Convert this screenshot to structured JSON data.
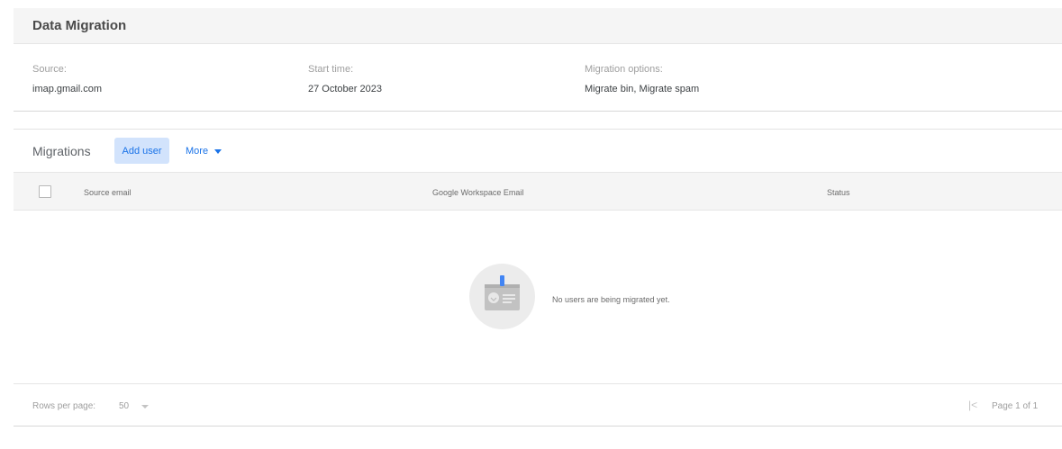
{
  "overview": {
    "title": "Data Migration",
    "source_label": "Source:",
    "source_value": "imap.gmail.com",
    "start_label": "Start time:",
    "start_value": "27 October 2023",
    "options_label": "Migration options:",
    "options_value": "Migrate bin, Migrate spam"
  },
  "migrations": {
    "title": "Migrations",
    "add_user_label": "Add user",
    "more_label": "More",
    "columns": [
      "Source email",
      "Google Workspace Email",
      "Status"
    ],
    "empty_message": "No users are being migrated yet.",
    "empty_icon": "id-card-icon"
  },
  "footer": {
    "rows_per_page_label": "Rows per page:",
    "rows_per_page_value": "50",
    "page_info": "Page 1 of 1",
    "first_page_glyph": "|<"
  },
  "colors": {
    "accent": "#1a73e8",
    "button_bg": "#d2e3fc",
    "header_bg": "#f5f5f5"
  }
}
